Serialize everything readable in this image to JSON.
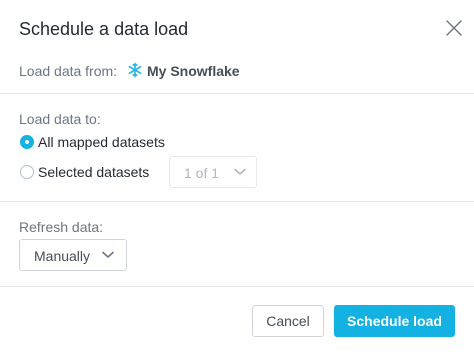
{
  "dialog": {
    "title": "Schedule a data load",
    "close_icon": "close-icon"
  },
  "source": {
    "label": "Load data from:",
    "icon": "snowflake-icon",
    "name": "My Snowflake"
  },
  "load_to": {
    "label": "Load data to:",
    "options": [
      {
        "label": "All mapped datasets",
        "selected": true
      },
      {
        "label": "Selected datasets",
        "selected": false
      }
    ],
    "dataset_count": "1 of 1"
  },
  "refresh": {
    "label": "Refresh data:",
    "value": "Manually"
  },
  "footer": {
    "cancel_label": "Cancel",
    "submit_label": "Schedule load"
  },
  "colors": {
    "accent": "#14b2e2",
    "snowflake": "#29b5e8",
    "title_text": "#1f2a33",
    "label_text": "#6d7680"
  }
}
